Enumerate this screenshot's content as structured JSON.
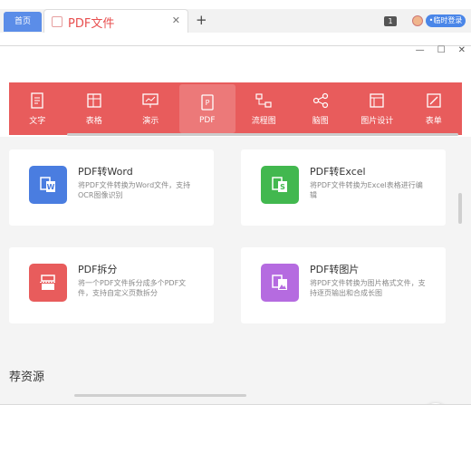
{
  "tabs": {
    "home": "首页",
    "doc": "PDF文件"
  },
  "badge": "1",
  "login": "•临时登录",
  "toolbar": [
    {
      "label": "文字",
      "icon": "text-doc-icon"
    },
    {
      "label": "表格",
      "icon": "table-icon"
    },
    {
      "label": "演示",
      "icon": "presentation-icon"
    },
    {
      "label": "PDF",
      "icon": "pdf-icon",
      "active": true
    },
    {
      "label": "流程图",
      "icon": "flowchart-icon"
    },
    {
      "label": "脑图",
      "icon": "mindmap-icon"
    },
    {
      "label": "图片设计",
      "icon": "image-design-icon"
    },
    {
      "label": "表单",
      "icon": "form-icon"
    }
  ],
  "cards": [
    {
      "title": "PDF转Word",
      "desc": "将PDF文件转换为Word文件，支持OCR图像识别",
      "color": "#4a7de0"
    },
    {
      "title": "PDF转Excel",
      "desc": "将PDF文件转换为Excel表格进行编辑",
      "color": "#42b84f"
    },
    {
      "title": "PDF拆分",
      "desc": "将一个PDF文件拆分成多个PDF文件，支持自定义页数拆分",
      "color": "#e85c5c"
    },
    {
      "title": "PDF转图片",
      "desc": "将PDF文件转换为图片格式文件，支持逐页输出和合成长图",
      "color": "#b56be0"
    }
  ],
  "section": "荐资源"
}
